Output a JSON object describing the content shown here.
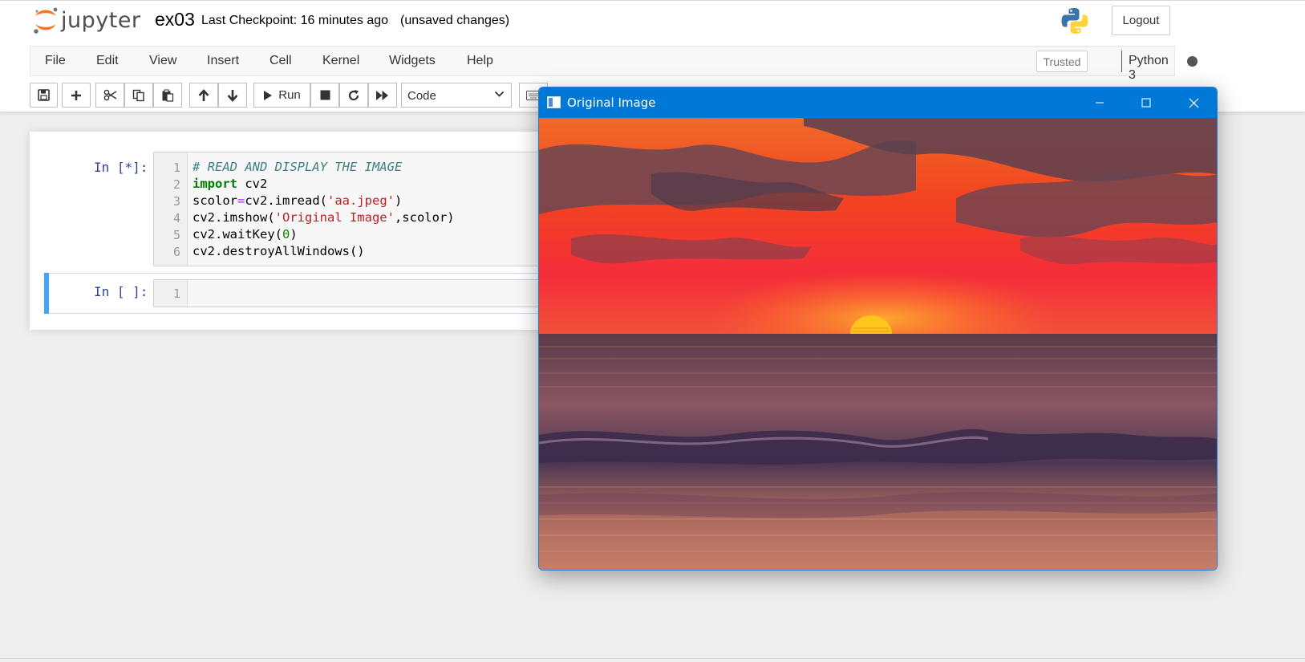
{
  "header": {
    "logo_text": "jupyter",
    "notebook_name": "ex03",
    "checkpoint": "Last Checkpoint: 16 minutes ago",
    "status": "(unsaved changes)",
    "logout_label": "Logout"
  },
  "menu": {
    "items": [
      "File",
      "Edit",
      "View",
      "Insert",
      "Cell",
      "Kernel",
      "Widgets",
      "Help"
    ],
    "trusted_label": "Trusted",
    "kernel_name": "Python 3"
  },
  "toolbar": {
    "run_label": "Run",
    "cell_type": "Code",
    "icons": [
      "save-icon",
      "plus-icon",
      "cut-icon",
      "copy-icon",
      "paste-icon",
      "arrow-up-icon",
      "arrow-down-icon",
      "play-icon",
      "stop-icon",
      "restart-icon",
      "fast-forward-icon",
      "keyboard-icon"
    ]
  },
  "cells": [
    {
      "prompt": "In [*]:",
      "line_numbers": [
        "1",
        "2",
        "3",
        "4",
        "5",
        "6"
      ]
    },
    {
      "prompt": "In [ ]:",
      "line_numbers": [
        "1"
      ]
    }
  ],
  "code": {
    "l1_comment": "# READ AND DISPLAY THE IMAGE",
    "l2_kw": "import",
    "l2_rest": " cv2",
    "l3_a": "scolor",
    "l3_op": "=",
    "l3_b": "cv2.imread(",
    "l3_str": "'aa.jpeg'",
    "l3_c": ")",
    "l4_a": "cv2.imshow(",
    "l4_str": "'Original Image'",
    "l4_b": ",scolor)",
    "l5_a": "cv2.waitKey(",
    "l5_num": "0",
    "l5_b": ")",
    "l6": "cv2.destroyAllWindows()"
  },
  "cv_window": {
    "title": "Original Image",
    "controls": [
      "minimize-icon",
      "maximize-icon",
      "close-icon"
    ]
  },
  "colors": {
    "titlebar": "#0078d7",
    "prompt": "#303f9f",
    "active_cell": "#42a5f5"
  }
}
